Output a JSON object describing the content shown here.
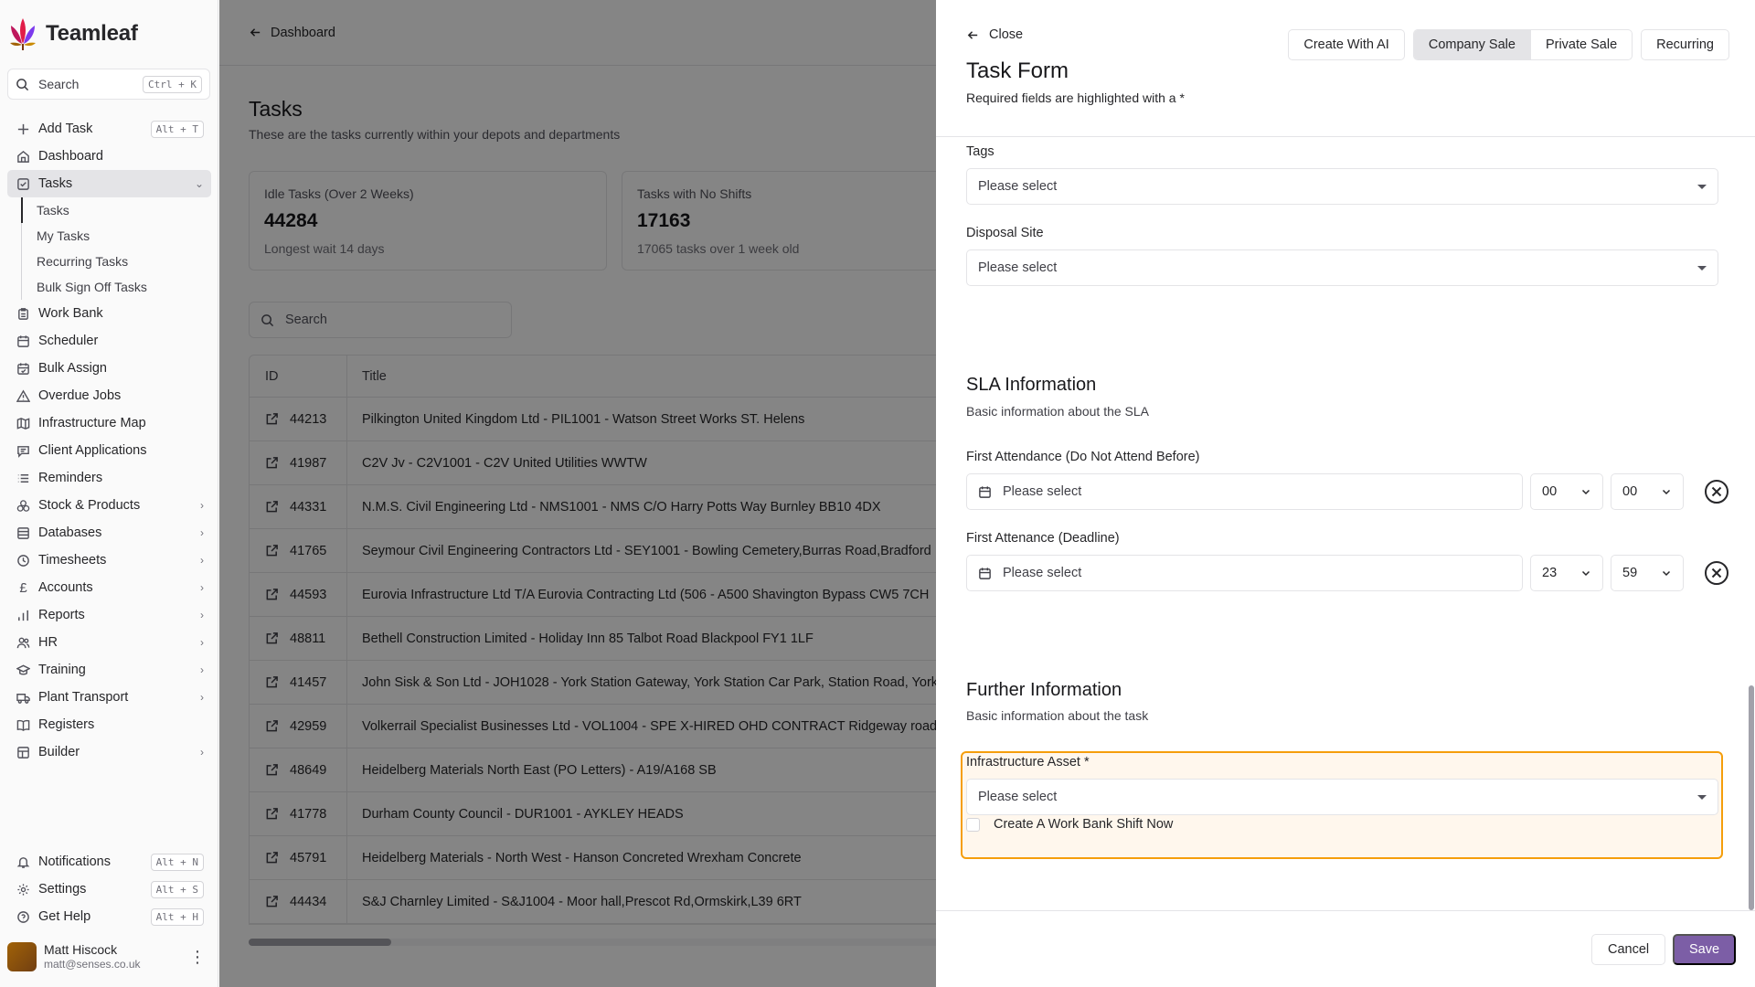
{
  "app": {
    "brand": "Teamleaf"
  },
  "sidebar": {
    "search_label": "Search",
    "search_shortcut": "Ctrl + K",
    "add_task": {
      "label": "Add Task",
      "shortcut": "Alt + T"
    },
    "items": [
      {
        "label": "Dashboard",
        "icon": "home-icon"
      },
      {
        "label": "Tasks",
        "icon": "checkbox-icon"
      },
      {
        "label": "Work Bank",
        "icon": "clipboard-icon"
      },
      {
        "label": "Scheduler",
        "icon": "calendar-icon"
      },
      {
        "label": "Bulk Assign",
        "icon": "calendar-check-icon"
      },
      {
        "label": "Overdue Jobs",
        "icon": "warning-icon"
      },
      {
        "label": "Infrastructure Map",
        "icon": "map-icon"
      },
      {
        "label": "Client Applications",
        "icon": "message-icon"
      },
      {
        "label": "Reminders",
        "icon": "list-icon"
      },
      {
        "label": "Stock & Products",
        "icon": "boxes-icon"
      },
      {
        "label": "Databases",
        "icon": "database-icon"
      },
      {
        "label": "Timesheets",
        "icon": "clock-icon"
      },
      {
        "label": "Accounts",
        "icon": "pound-icon"
      },
      {
        "label": "Reports",
        "icon": "bar-chart-icon"
      },
      {
        "label": "HR",
        "icon": "users-icon"
      },
      {
        "label": "Training",
        "icon": "graduation-cap-icon"
      },
      {
        "label": "Plant Transport",
        "icon": "truck-icon"
      },
      {
        "label": "Registers",
        "icon": "book-icon"
      },
      {
        "label": "Builder",
        "icon": "layout-icon"
      }
    ],
    "tasks_sub": [
      "Tasks",
      "My Tasks",
      "Recurring Tasks",
      "Bulk Sign Off Tasks"
    ],
    "bottom": [
      {
        "label": "Notifications",
        "shortcut": "Alt + N"
      },
      {
        "label": "Settings",
        "shortcut": "Alt + S"
      },
      {
        "label": "Get Help",
        "shortcut": "Alt + H"
      }
    ],
    "user": {
      "name": "Matt Hiscock",
      "email": "matt@senses.co.uk"
    }
  },
  "main": {
    "breadcrumb": "Dashboard",
    "title": "Tasks",
    "subtitle": "These are the tasks currently within your depots and departments",
    "stats": [
      {
        "label": "Idle Tasks (Over 2 Weeks)",
        "value": "44284",
        "note": "Longest wait 14 days"
      },
      {
        "label": "Tasks with No Shifts",
        "value": "17163",
        "note": "17065 tasks over 1 week old"
      }
    ],
    "search_placeholder": "Search",
    "table": {
      "headers": [
        "ID",
        "Title"
      ],
      "rows": [
        {
          "id": "44213",
          "title": "Pilkington United Kingdom Ltd - PIL1001 - Watson Street Works ST. Helens"
        },
        {
          "id": "41987",
          "title": "C2V Jv - C2V1001 - C2V United Utilities WWTW"
        },
        {
          "id": "44331",
          "title": "N.M.S. Civil Engineering Ltd - NMS1001 - NMS C/O Harry Potts Way Burnley BB10 4DX"
        },
        {
          "id": "41765",
          "title": "Seymour Civil Engineering Contractors Ltd - SEY1001 - Bowling Cemetery,Burras Road,Bradford"
        },
        {
          "id": "44593",
          "title": "Eurovia Infrastructure Ltd T/A Eurovia Contracting Ltd (506 - A500 Shavington Bypass CW5 7CH"
        },
        {
          "id": "48811",
          "title": "Bethell Construction Limited - Holiday Inn 85 Talbot Road Blackpool FY1 1LF"
        },
        {
          "id": "41457",
          "title": "John Sisk & Son Ltd - JOH1028 - York Station Gateway, York Station Car Park, Station Road, York"
        },
        {
          "id": "42959",
          "title": "Volkerrail Specialist Businesses Ltd - VOL1004 - SPE X-HIRED OHD CONTRACT Ridgeway road/"
        },
        {
          "id": "48649",
          "title": "Heidelberg Materials North East (PO Letters) - A19/A168 SB"
        },
        {
          "id": "41778",
          "title": "Durham County Council - DUR1001 - AYKLEY HEADS"
        },
        {
          "id": "45791",
          "title": "Heidelberg Materials - North West - Hanson Concreted Wrexham Concrete"
        },
        {
          "id": "44434",
          "title": "S&J Charnley Limited - S&J1004 - Moor hall,Prescot Rd,Ormskirk,L39 6RT"
        }
      ]
    }
  },
  "drawer": {
    "close_label": "Close",
    "title": "Task Form",
    "subtitle": "Required fields are highlighted with a *",
    "create_ai": "Create With AI",
    "modes": [
      "Company Sale",
      "Private Sale"
    ],
    "selected_mode": "Company Sale",
    "recurring": "Recurring",
    "fields": {
      "tags": {
        "label": "Tags",
        "placeholder": "Please select"
      },
      "disposal": {
        "label": "Disposal Site",
        "placeholder": "Please select"
      }
    },
    "sla": {
      "title": "SLA Information",
      "subtitle": "Basic information about the SLA",
      "first_attendance": {
        "label": "First Attendance (Do Not Attend Before)",
        "placeholder": "Please select",
        "hour": "00",
        "minute": "00"
      },
      "deadline": {
        "label": "First Attenance (Deadline)",
        "placeholder": "Please select",
        "hour": "23",
        "minute": "59"
      }
    },
    "further": {
      "title": "Further Information",
      "subtitle": "Basic information about the task",
      "asset": {
        "label": "Infrastructure Asset *",
        "placeholder": "Please select"
      },
      "work_bank_checkbox": "Create A Work Bank Shift Now"
    },
    "cancel": "Cancel",
    "save": "Save"
  },
  "colors": {
    "accent": "#7c5ea6",
    "highlight": "#f59e0b"
  }
}
